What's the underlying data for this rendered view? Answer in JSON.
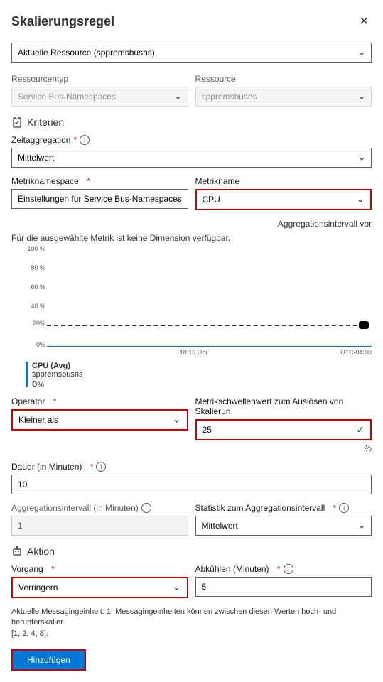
{
  "header": {
    "title": "Skalierungsregel"
  },
  "source_select": {
    "value": "Aktuelle Ressource (sppremsbusns)"
  },
  "resource_type": {
    "label": "Ressourcentyp",
    "value": "Service Bus-Namespaces"
  },
  "resource": {
    "label": "Ressource",
    "value": "sppremsbusns"
  },
  "criteria": {
    "title": "Kriterien"
  },
  "time_agg": {
    "label": "Zeitaggregation",
    "value": "Mittelwert"
  },
  "metric_ns": {
    "label": "Metriknamespace",
    "value": "Einstellungen für Service Bus-Namespaces Standard"
  },
  "metric_name": {
    "label": "Metrikname",
    "value": "CPU"
  },
  "agg_interval_link": "Aggregationsintervall vor",
  "no_dimension": "Für die ausgewählte Metrik ist keine Dimension verfügbar.",
  "chart_data": {
    "type": "line",
    "y_ticks": [
      "100 %",
      "80 %",
      "60 %",
      "40 %",
      "20 %",
      "0%"
    ],
    "x_ticks": [
      "18:10 Uhr",
      "UTC-04:00"
    ],
    "threshold": 25,
    "current_value": 0,
    "ylim": [
      0,
      100
    ],
    "series": [
      {
        "name": "CPU (Avg) sppremsbusns",
        "values": [
          0
        ]
      }
    ]
  },
  "legend": {
    "name": "CPU (Avg)",
    "resource": "sppremsbusns",
    "value": "0",
    "suffix": "%"
  },
  "operator": {
    "label": "Operator",
    "value": "Kleiner als"
  },
  "threshold": {
    "label": "Metrikschwellenwert zum Auslösen von Skalierun",
    "value": "25",
    "unit": "%"
  },
  "duration": {
    "label": "Dauer (in Minuten)",
    "value": "10"
  },
  "agg_int": {
    "label": "Aggregationsintervall (in Minuten)",
    "value": "1"
  },
  "agg_stat": {
    "label": "Statistik zum Aggregationsintervall",
    "value": "Mittelwert"
  },
  "action": {
    "title": "Aktion"
  },
  "operation": {
    "label": "Vorgang",
    "value": "Verringern"
  },
  "cooldown": {
    "label": "Abkühlen (Minuten)",
    "value": "5"
  },
  "footer": {
    "note1": "Aktuelle Messagingeinheit: 1. Messagingeinheiten können zwischen diesen Werten hoch- und herunterskalier",
    "note2": "[1, 2, 4, 8]."
  },
  "buttons": {
    "add": "Hinzufügen"
  }
}
